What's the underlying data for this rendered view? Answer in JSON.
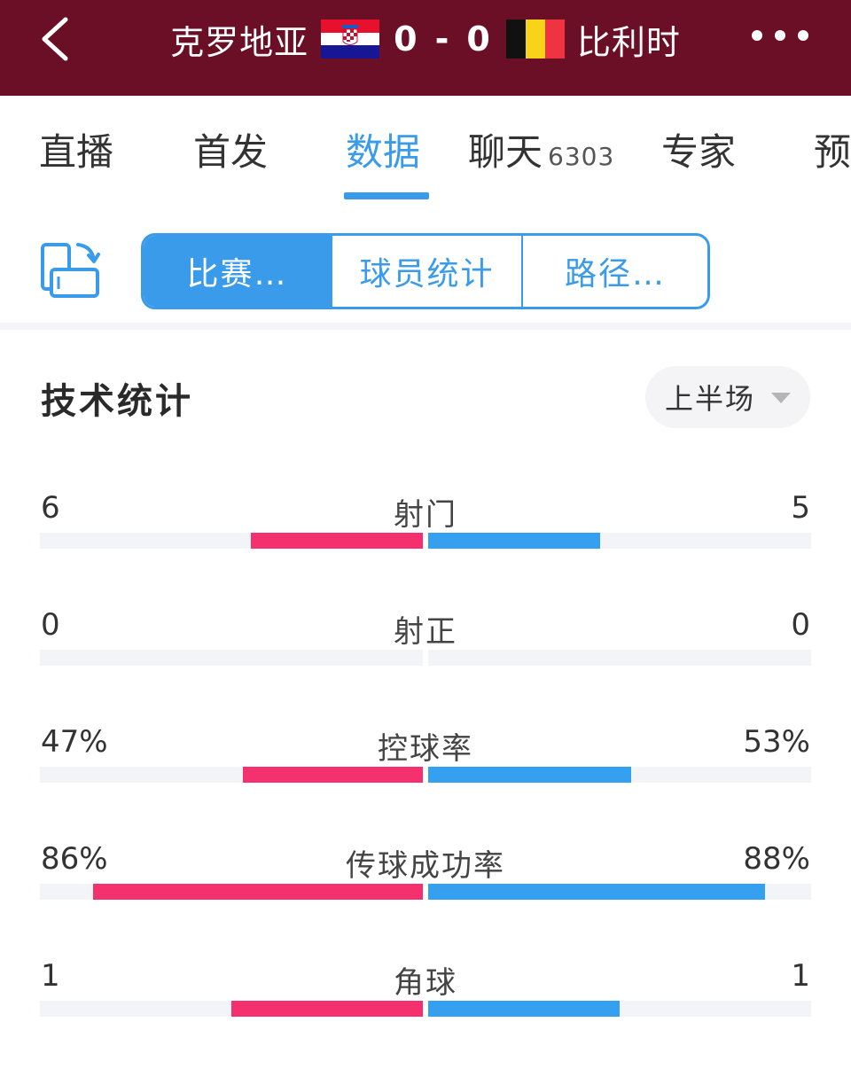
{
  "header": {
    "home_team": "克罗地亚",
    "away_team": "比利时",
    "home_score": "0",
    "separator": "-",
    "away_score": "0"
  },
  "tabs": [
    {
      "label": "直播"
    },
    {
      "label": "首发"
    },
    {
      "label": "数据",
      "active": true
    },
    {
      "label": "聊天",
      "count": "6303"
    },
    {
      "label": "专家"
    },
    {
      "label": "预"
    }
  ],
  "segments": [
    {
      "label": "比赛…",
      "active": true
    },
    {
      "label": "球员统计"
    },
    {
      "label": "路径…"
    }
  ],
  "stats_section": {
    "title": "技术统计",
    "period": "上半场"
  },
  "stats": [
    {
      "label": "射门",
      "left": "6",
      "right": "5",
      "left_fill": 0.45,
      "right_fill": 0.45
    },
    {
      "label": "射正",
      "left": "0",
      "right": "0",
      "left_fill": 0,
      "right_fill": 0
    },
    {
      "label": "控球率",
      "left": "47%",
      "right": "53%",
      "left_fill": 0.47,
      "right_fill": 0.53
    },
    {
      "label": "传球成功率",
      "left": "86%",
      "right": "88%",
      "left_fill": 0.86,
      "right_fill": 0.88
    },
    {
      "label": "角球",
      "left": "1",
      "right": "1",
      "left_fill": 0.5,
      "right_fill": 0.5
    }
  ],
  "colors": {
    "header_bg": "#6b0f26",
    "accent_blue": "#3a9bea",
    "home_bar": "#f5306f",
    "away_bar": "#35a0f0"
  },
  "icons": {
    "back": "chevron-left-icon",
    "more": "more-dots-icon",
    "rotate": "rotate-screen-icon",
    "caret": "caret-down-icon",
    "home_flag": "croatia-flag-icon",
    "away_flag": "belgium-flag-icon"
  }
}
